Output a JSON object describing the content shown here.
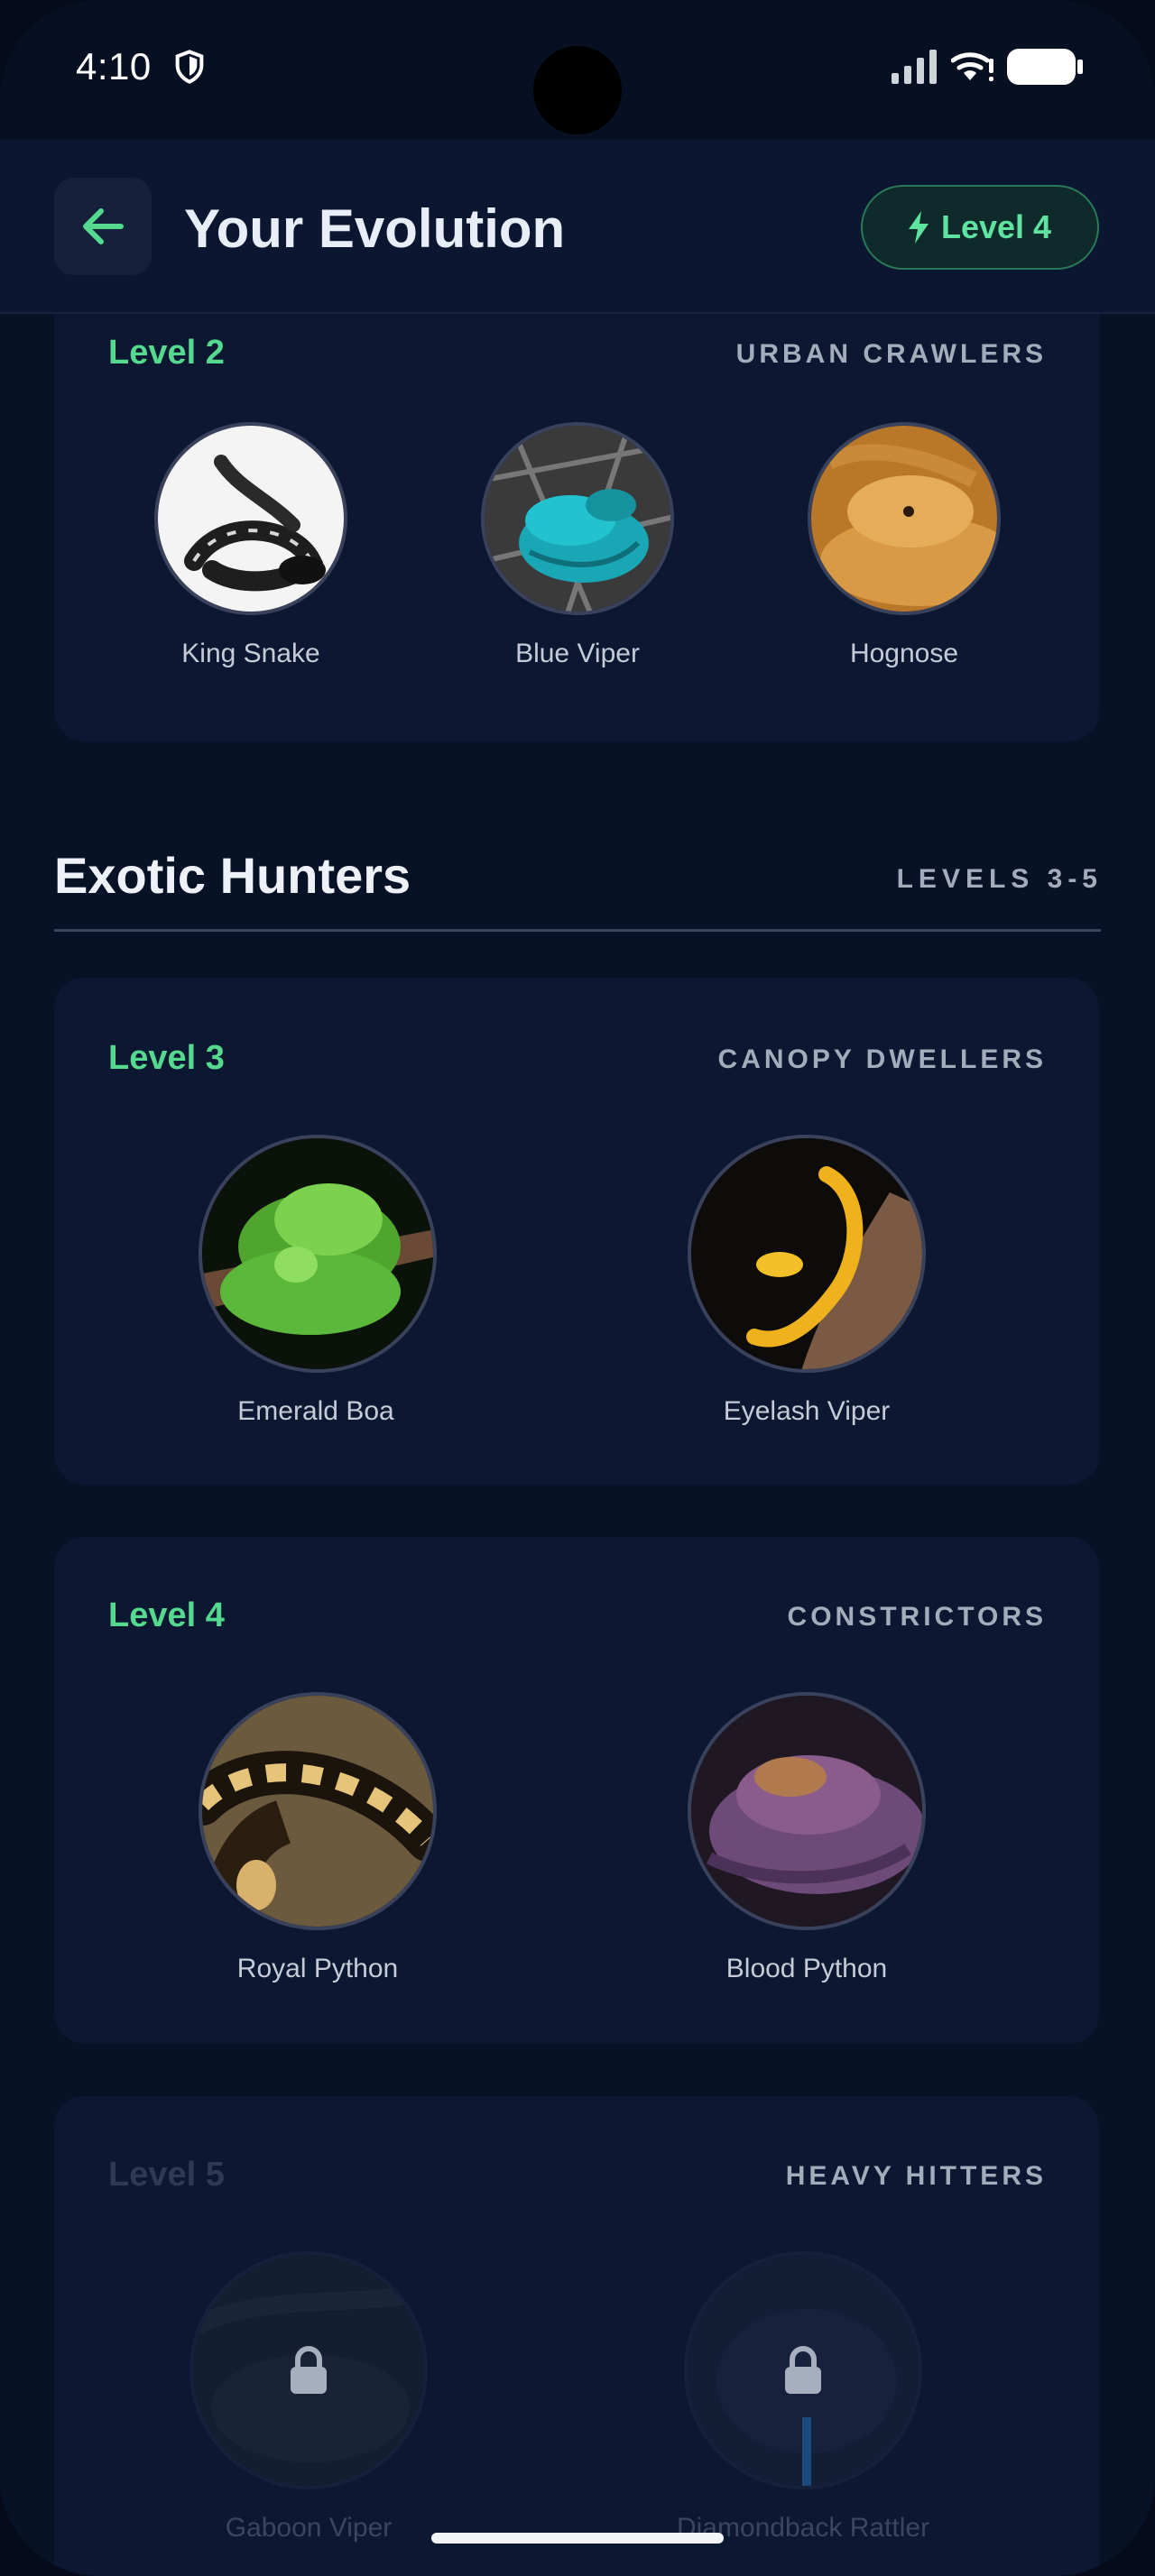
{
  "status_bar": {
    "time": "4:10"
  },
  "header": {
    "title": "Your Evolution",
    "level_badge": "Level 4"
  },
  "cards": [
    {
      "level": "Level 2",
      "tag": "URBAN CRAWLERS",
      "locked": false,
      "snakes": [
        {
          "name": "King Snake"
        },
        {
          "name": "Blue Viper"
        },
        {
          "name": "Hognose"
        }
      ]
    },
    {
      "level": "Level 3",
      "tag": "CANOPY DWELLERS",
      "locked": false,
      "snakes": [
        {
          "name": "Emerald Boa"
        },
        {
          "name": "Eyelash Viper"
        }
      ]
    },
    {
      "level": "Level 4",
      "tag": "CONSTRICTORS",
      "locked": false,
      "snakes": [
        {
          "name": "Royal Python"
        },
        {
          "name": "Blood Python"
        }
      ]
    },
    {
      "level": "Level 5",
      "tag": "HEAVY HITTERS",
      "locked": true,
      "snakes": [
        {
          "name": "Gaboon Viper"
        },
        {
          "name": "Diamondback Rattler"
        }
      ]
    }
  ],
  "section": {
    "title": "Exotic Hunters",
    "range": "LEVELS 3-5"
  },
  "colors": {
    "accent": "#55d98f",
    "background": "#081226",
    "card": "#0c1831"
  },
  "icons": {
    "back": "arrow-left-icon",
    "level": "lightning-bolt-icon",
    "locked": "lock-icon"
  }
}
